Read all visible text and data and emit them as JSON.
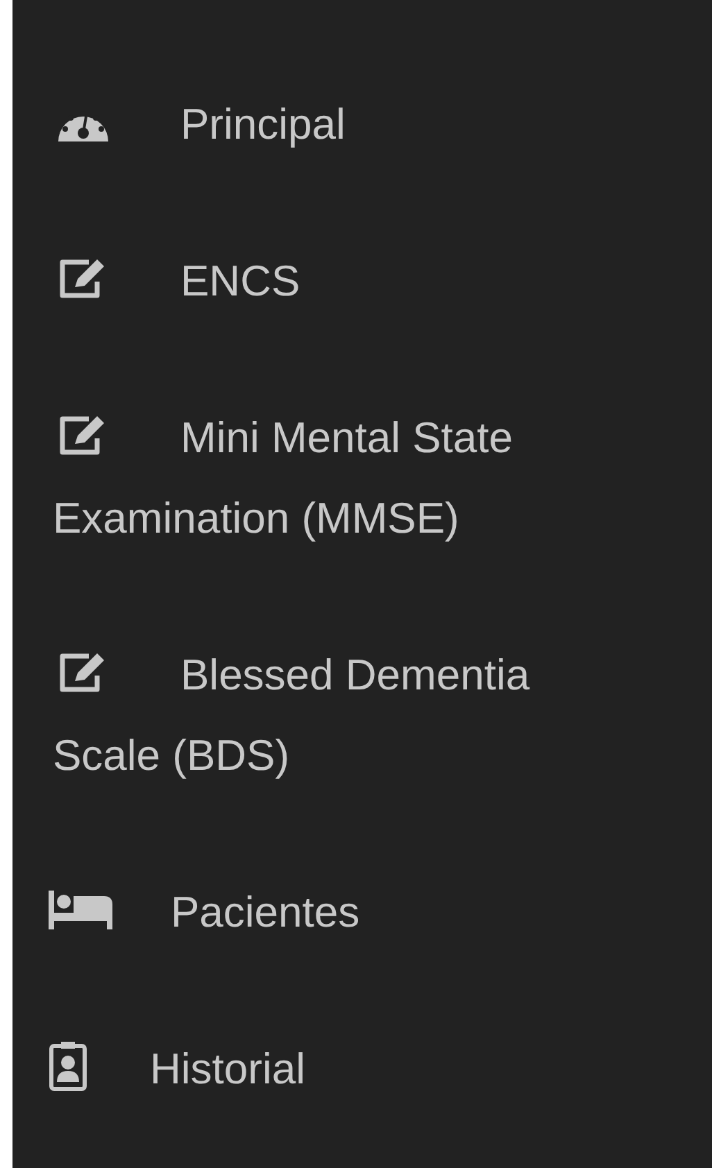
{
  "sidebar": {
    "items": [
      {
        "kind": "dashboard",
        "label": "Principal"
      },
      {
        "kind": "edit",
        "label": "ENCS"
      },
      {
        "kind": "edit",
        "label": "Mini Mental State Examination (MMSE)"
      },
      {
        "kind": "edit",
        "label": "Blessed Dementia Scale (BDS)"
      },
      {
        "kind": "bed",
        "label": "Pacientes"
      },
      {
        "kind": "record",
        "label": "Historial"
      }
    ]
  }
}
